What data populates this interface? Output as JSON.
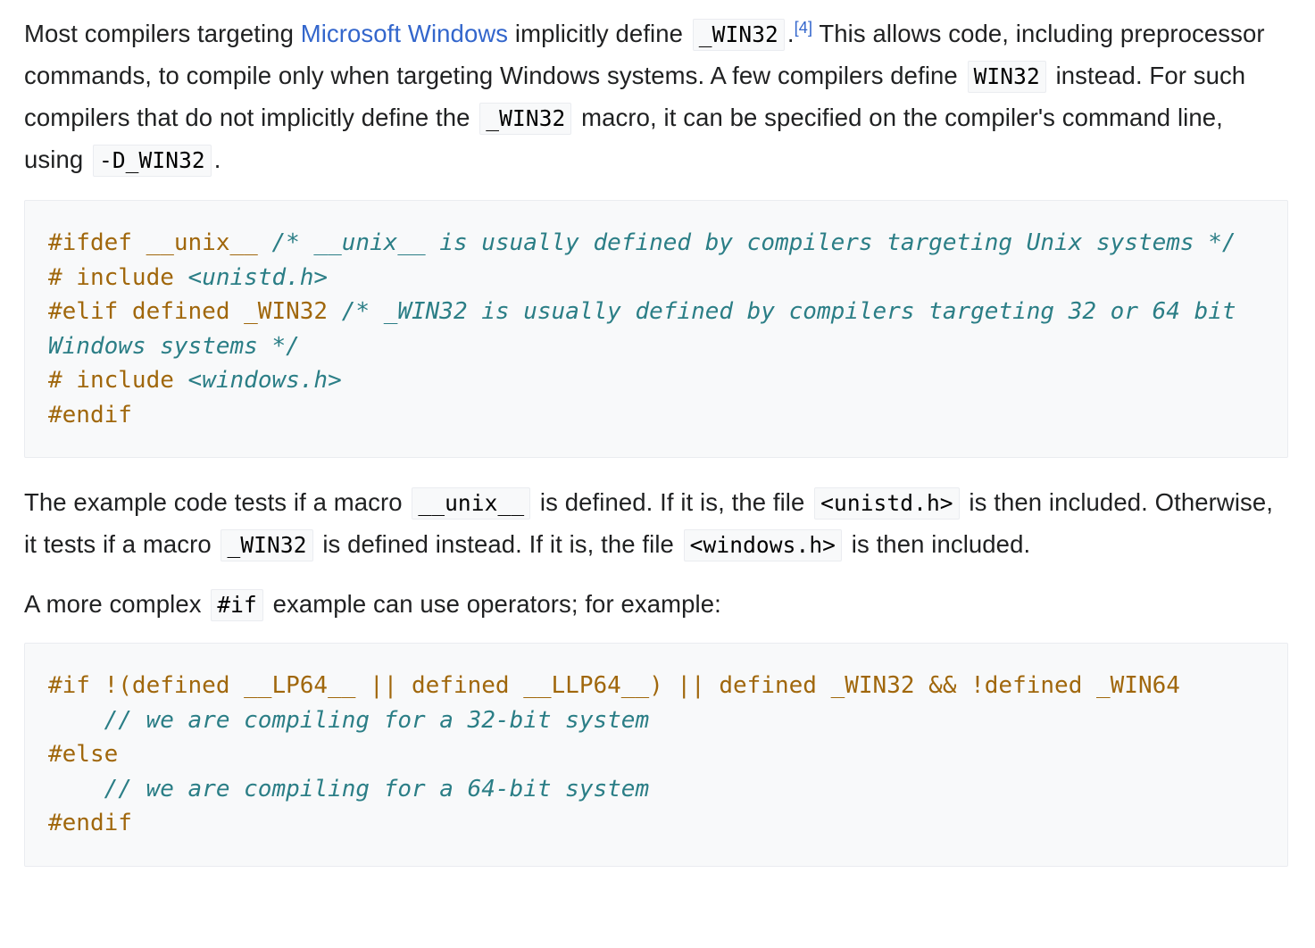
{
  "article": {
    "paragraph_1": {
      "segments": [
        {
          "type": "text",
          "text": "Most compilers targeting "
        },
        {
          "type": "link",
          "text": "Microsoft Windows"
        },
        {
          "type": "text",
          "text": " implicitly define "
        },
        {
          "type": "code",
          "text": "_WIN32"
        },
        {
          "type": "text",
          "text": "."
        },
        {
          "type": "ref",
          "text": "[4]"
        },
        {
          "type": "text",
          "text": " This allows code, including preprocessor commands, to compile only when targeting Windows systems. A few compilers define "
        },
        {
          "type": "code",
          "text": "WIN32"
        },
        {
          "type": "text",
          "text": " instead. For such compilers that do not implicitly define the "
        },
        {
          "type": "code",
          "text": "_WIN32"
        },
        {
          "type": "text",
          "text": " macro, it can be specified on the compiler's command line, using "
        },
        {
          "type": "code",
          "text": "-D_WIN32"
        },
        {
          "type": "text",
          "text": "."
        }
      ],
      "text_1": "Most compilers targeting ",
      "link_1": "Microsoft Windows",
      "text_2": " implicitly define ",
      "code_1": "_WIN32",
      "text_3": ".",
      "ref_1": "[4]",
      "text_4": " This allows code, including preprocessor commands, to compile only when targeting Windows systems. A few compilers define ",
      "code_2": "WIN32",
      "text_5": " instead. For such compilers that do not implicitly define the ",
      "code_3": "_WIN32",
      "text_6": " macro, it can be specified on the compiler's command line, using ",
      "code_4": "-D_WIN32",
      "text_7": "."
    },
    "code_block_1": {
      "language": "c",
      "lines": [
        {
          "tokens": [
            {
              "cls": "cp",
              "text": "#ifdef __unix__ "
            },
            {
              "cls": "cmt",
              "text": "/* __unix__ is usually defined by compilers targeting Unix systems */"
            }
          ]
        },
        {
          "tokens": [
            {
              "cls": "cp",
              "text": "# include "
            },
            {
              "cls": "hdr",
              "text": "<unistd.h>"
            }
          ]
        },
        {
          "tokens": [
            {
              "cls": "cp",
              "text": "#elif defined _WIN32 "
            },
            {
              "cls": "cmt",
              "text": "/* _WIN32 is usually defined by compilers targeting 32 or 64 bit Windows systems */"
            }
          ]
        },
        {
          "tokens": [
            {
              "cls": "cp",
              "text": "# include "
            },
            {
              "cls": "hdr",
              "text": "<windows.h>"
            }
          ]
        },
        {
          "tokens": [
            {
              "cls": "cp",
              "text": "#endif"
            }
          ]
        }
      ],
      "plain_text": "#ifdef __unix__ /* __unix__ is usually defined by compilers targeting Unix systems */\n# include <unistd.h>\n#elif defined _WIN32 /* _WIN32 is usually defined by compilers targeting 32 or 64 bit Windows systems */\n# include <windows.h>\n#endif"
    },
    "paragraph_2": {
      "text_1": "The example code tests if a macro ",
      "code_1": "__unix__",
      "text_2": " is defined. If it is, the file ",
      "code_2": "<unistd.h>",
      "text_3": " is then included. Otherwise, it tests if a macro ",
      "code_3": "_WIN32",
      "text_4": " is defined instead. If it is, the file ",
      "code_4": "<windows.h>",
      "text_5": " is then included."
    },
    "paragraph_3": {
      "text_1": "A more complex ",
      "code_1": "#if",
      "text_2": " example can use operators; for example:"
    },
    "code_block_2": {
      "language": "c",
      "lines": [
        {
          "tokens": [
            {
              "cls": "cp",
              "text": "#if !(defined __LP64__ || defined __LLP64__) || defined _WIN32 && !defined _WIN64"
            }
          ]
        },
        {
          "tokens": [
            {
              "cls": "cmt",
              "text": "    // we are compiling for a 32-bit system"
            }
          ]
        },
        {
          "tokens": [
            {
              "cls": "cp",
              "text": "#else"
            }
          ]
        },
        {
          "tokens": [
            {
              "cls": "cmt",
              "text": "    // we are compiling for a 64-bit system"
            }
          ]
        },
        {
          "tokens": [
            {
              "cls": "cp",
              "text": "#endif"
            }
          ]
        }
      ],
      "plain_text": "#if !(defined __LP64__ || defined __LLP64__) || defined _WIN32 && !defined _WIN64\n    // we are compiling for a 32-bit system\n#else\n    // we are compiling for a 64-bit system\n#endif"
    }
  },
  "colors": {
    "link": "#3366cc",
    "text": "#202122",
    "code_bg": "#f8f9fa",
    "code_border": "#eaecf0",
    "preprocessor": "#a0670c",
    "comment": "#2b7e86"
  }
}
